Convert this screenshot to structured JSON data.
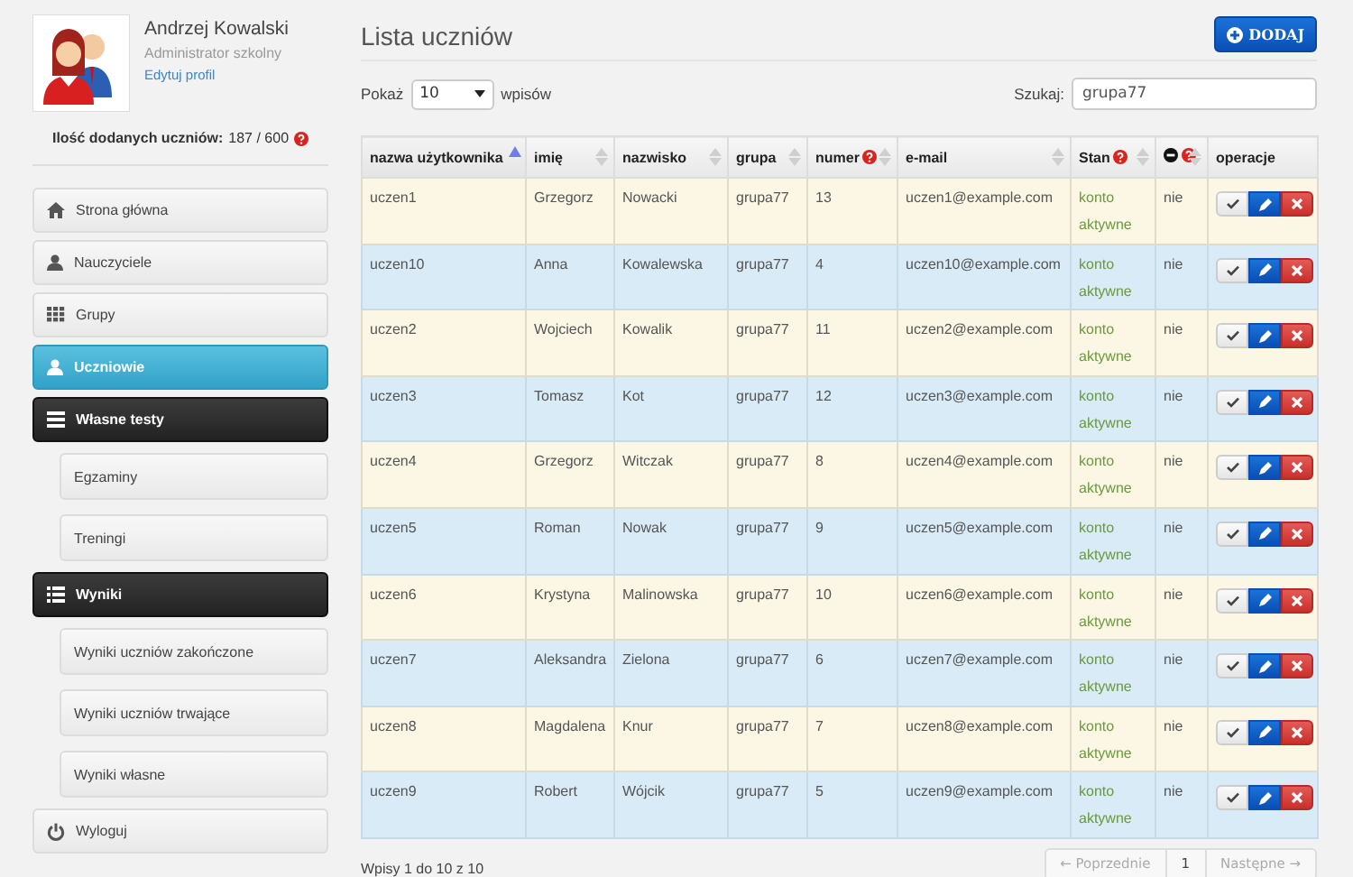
{
  "profile": {
    "name": "Andrzej Kowalski",
    "role": "Administrator szkolny",
    "edit_link": "Edytuj profil",
    "count_label": "Ilość dodanych uczniów:",
    "count": "187 / 600"
  },
  "sidebar": {
    "items": [
      {
        "label": "Strona główna",
        "selected": false
      },
      {
        "label": "Nauczyciele",
        "selected": false
      },
      {
        "label": "Grupy",
        "selected": false
      },
      {
        "label": "Uczniowie",
        "selected": true
      },
      {
        "label": "Własne testy",
        "selected": false,
        "children": [
          {
            "label": "Egzaminy",
            "selected": false
          },
          {
            "label": "Treningi",
            "selected": false
          }
        ]
      },
      {
        "label": "Wyniki",
        "selected": false,
        "children": [
          {
            "label": "Wyniki uczniów zakończone",
            "selected": false
          },
          {
            "label": "Wyniki uczniów trwające",
            "selected": false
          },
          {
            "label": "Wyniki własne",
            "selected": false
          }
        ]
      },
      {
        "label": "Wyloguj",
        "selected": false
      }
    ]
  },
  "page_title": "Lista uczniów",
  "add_button": "DODAJ",
  "length": {
    "label_before": "Pokaż",
    "value": "10",
    "label_after": "wpisów"
  },
  "search": {
    "label": "Szukaj:",
    "value": "grupa77"
  },
  "table": {
    "columns": [
      {
        "label": "nazwa użytkownika",
        "sortable": true,
        "sorted": true,
        "help": false
      },
      {
        "label": "imię",
        "sortable": true,
        "sorted": false,
        "help": false
      },
      {
        "label": "nazwisko",
        "sortable": true,
        "sorted": false,
        "help": false
      },
      {
        "label": "grupa",
        "sortable": true,
        "sorted": false,
        "help": false
      },
      {
        "label": "numer",
        "sortable": true,
        "sorted": false,
        "help": true
      },
      {
        "label": "e-mail",
        "sortable": true,
        "sorted": false,
        "help": false
      },
      {
        "label": "Stan",
        "sortable": true,
        "sorted": false,
        "help": true
      },
      {
        "kind": "blocked",
        "sortable": true,
        "sorted": false,
        "help": true
      },
      {
        "label": "operacje",
        "sortable": false,
        "sorted": false,
        "help": false
      }
    ],
    "rows": [
      [
        "uczen1",
        "Grzegorz",
        "Nowacki",
        "grupa77",
        "13",
        "uczen1@example.com",
        "konto aktywne",
        "nie"
      ],
      [
        "uczen10",
        "Anna",
        "Kowalewska",
        "grupa77",
        "4",
        "uczen10@example.com",
        "konto aktywne",
        "nie"
      ],
      [
        "uczen2",
        "Wojciech",
        "Kowalik",
        "grupa77",
        "11",
        "uczen2@example.com",
        "konto aktywne",
        "nie"
      ],
      [
        "uczen3",
        "Tomasz",
        "Kot",
        "grupa77",
        "12",
        "uczen3@example.com",
        "konto aktywne",
        "nie"
      ],
      [
        "uczen4",
        "Grzegorz",
        "Witczak",
        "grupa77",
        "8",
        "uczen4@example.com",
        "konto aktywne",
        "nie"
      ],
      [
        "uczen5",
        "Roman",
        "Nowak",
        "grupa77",
        "9",
        "uczen5@example.com",
        "konto aktywne",
        "nie"
      ],
      [
        "uczen6",
        "Krystyna",
        "Malinowska",
        "grupa77",
        "10",
        "uczen6@example.com",
        "konto aktywne",
        "nie"
      ],
      [
        "uczen7",
        "Aleksandra",
        "Zielona",
        "grupa77",
        "6",
        "uczen7@example.com",
        "konto aktywne",
        "nie"
      ],
      [
        "uczen8",
        "Magdalena",
        "Knur",
        "grupa77",
        "7",
        "uczen8@example.com",
        "konto aktywne",
        "nie"
      ],
      [
        "uczen9",
        "Robert",
        "Wójcik",
        "grupa77",
        "5",
        "uczen9@example.com",
        "konto aktywne",
        "nie"
      ]
    ]
  },
  "info": "Wpisy 1 do 10 z 10",
  "pagination": [
    {
      "label": "← Poprzednie",
      "disabled": true
    },
    {
      "label": "1",
      "disabled": false
    },
    {
      "label": "Następne →",
      "disabled": true
    }
  ]
}
